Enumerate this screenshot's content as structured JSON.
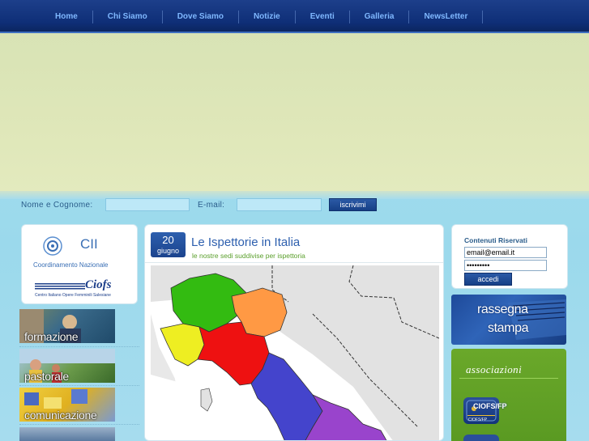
{
  "nav": {
    "items": [
      {
        "label": "Home"
      },
      {
        "label": "Chi Siamo"
      },
      {
        "label": "Dove Siamo"
      },
      {
        "label": "Notizie"
      },
      {
        "label": "Eventi"
      },
      {
        "label": "Galleria"
      },
      {
        "label": "NewsLetter"
      }
    ]
  },
  "newsletter": {
    "name_label": "Nome e Cognome:",
    "email_label": "E-mail:",
    "name_value": "",
    "email_value": "",
    "subscribe_label": "iscrivimi"
  },
  "left": {
    "cii_title": "CII",
    "cii_subtitle": "Coordinamento Nazionale",
    "ciofs_logo": "Ciofs",
    "ciofs_caption": "Centro Italiano Opere Femminili Salesiane",
    "sections": [
      {
        "label": "formazione",
        "color": "#3a6a8a"
      },
      {
        "label": "pastorale",
        "color": "#4a7a3a"
      },
      {
        "label": "comunicazione",
        "color": "#e0b020"
      },
      {
        "label": "",
        "color": "#5a7aa0"
      }
    ]
  },
  "post": {
    "day": "20",
    "month": "giugno",
    "title": "Le Ispettorie in Italia",
    "subtitle": "le nostre sedi suddivise per ispettoria"
  },
  "login": {
    "title": "Contenuti Riservati",
    "email_value": "email@email.it",
    "password_value": "•••••••••",
    "submit_label": "accedi"
  },
  "rassegna": {
    "line1": "rassegna",
    "line2": "stampa"
  },
  "associazioni": {
    "title": "associazioni",
    "item_label": "CIOFS/FP",
    "item_caption": "CIOFS/FP"
  },
  "colors": {
    "nav_bg": "#0f2f78",
    "nav_link": "#7fb8ff",
    "banner": "#dfe7b9",
    "page_bg": "#a6dcee",
    "region_green": "#33bb11",
    "region_orange": "#ff9944",
    "region_yellow": "#eeee22",
    "region_red": "#ee1111",
    "region_blue": "#4444cc",
    "region_purple": "#9944cc"
  }
}
